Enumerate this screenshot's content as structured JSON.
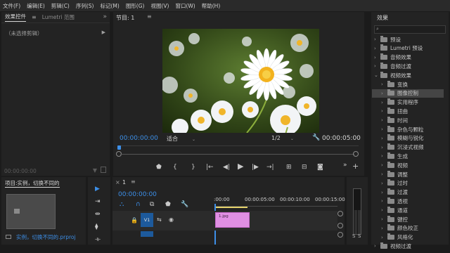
{
  "menu": [
    "文件(F)",
    "编辑(E)",
    "剪辑(C)",
    "序列(S)",
    "标记(M)",
    "图形(G)",
    "视图(V)",
    "窗口(W)",
    "帮助(H)"
  ],
  "left_panel": {
    "tabs": [
      "效果控件",
      "Lumetri 范围"
    ],
    "tab_menu": "»",
    "no_clip_text": "（未选择剪辑）",
    "timecode": "00:00:00:00"
  },
  "program": {
    "title": "节目: 1",
    "timecode_current": "00:00:00:00",
    "fit": "适合",
    "resolution": "1/2",
    "timecode_duration": "00:00:05:00"
  },
  "project": {
    "title": "项目:实例，切换不同的",
    "file_name": "实例，切换不同的.prproj"
  },
  "timeline": {
    "tab": "1",
    "timecode": "00:00:00:00",
    "ruler": [
      ":00:00",
      "00:00:05:00",
      "00:00:10:00",
      "00:00:15:00"
    ],
    "track": "V1",
    "clip_label": "1.jpg",
    "meter_labels": [
      "S",
      "S"
    ]
  },
  "effects": {
    "title": "效果",
    "search_placeholder": "",
    "items": [
      {
        "label": "预设",
        "level": 0,
        "open": false
      },
      {
        "label": "Lumetri 预设",
        "level": 0,
        "open": false
      },
      {
        "label": "音频效果",
        "level": 0,
        "open": false
      },
      {
        "label": "音频过渡",
        "level": 0,
        "open": false
      },
      {
        "label": "视频效果",
        "level": 0,
        "open": true
      },
      {
        "label": "变换",
        "level": 1,
        "open": false
      },
      {
        "label": "图像控制",
        "level": 1,
        "open": false,
        "selected": true
      },
      {
        "label": "实用程序",
        "level": 1,
        "open": false
      },
      {
        "label": "扭曲",
        "level": 1,
        "open": false
      },
      {
        "label": "时间",
        "level": 1,
        "open": false
      },
      {
        "label": "杂色与颗粒",
        "level": 1,
        "open": false
      },
      {
        "label": "模糊与锐化",
        "level": 1,
        "open": false
      },
      {
        "label": "沉浸式视频",
        "level": 1,
        "open": false
      },
      {
        "label": "生成",
        "level": 1,
        "open": false
      },
      {
        "label": "视频",
        "level": 1,
        "open": false
      },
      {
        "label": "调整",
        "level": 1,
        "open": false
      },
      {
        "label": "过时",
        "level": 1,
        "open": false
      },
      {
        "label": "过渡",
        "level": 1,
        "open": false
      },
      {
        "label": "透视",
        "level": 1,
        "open": false
      },
      {
        "label": "通道",
        "level": 1,
        "open": false
      },
      {
        "label": "键控",
        "level": 1,
        "open": false
      },
      {
        "label": "颜色校正",
        "level": 1,
        "open": false
      },
      {
        "label": "风格化",
        "level": 1,
        "open": false
      },
      {
        "label": "视频过渡",
        "level": 0,
        "open": false
      }
    ]
  },
  "colors": {
    "accent": "#3d8fe8",
    "clip": "#e08fe3",
    "selection": "#454545"
  }
}
